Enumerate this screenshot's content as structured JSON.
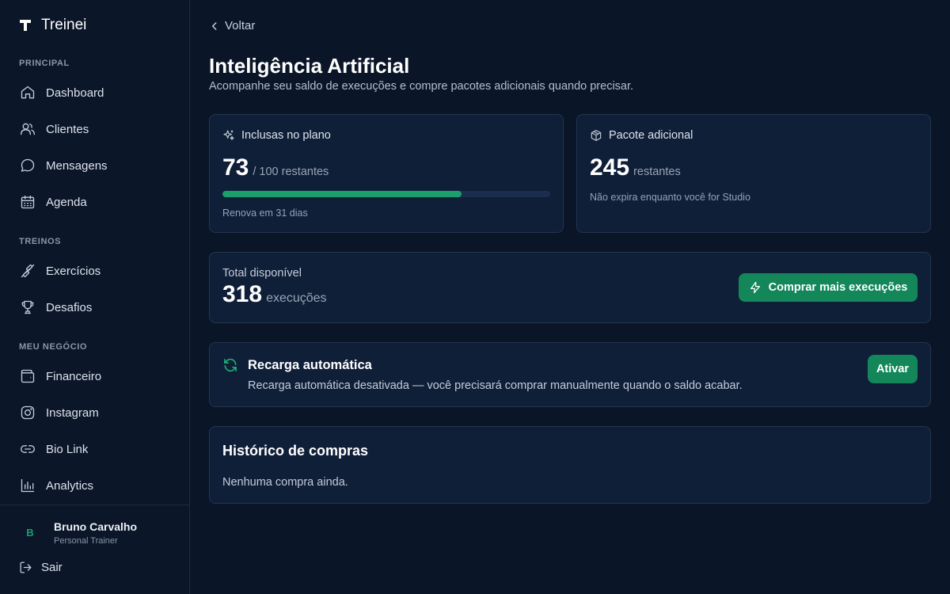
{
  "app": {
    "name": "Treinei"
  },
  "sidebar": {
    "sections": [
      {
        "title": "PRINCIPAL"
      },
      {
        "title": "TREINOS"
      },
      {
        "title": "MEU NEGÓCIO"
      }
    ],
    "items": [
      {
        "label": "Dashboard",
        "icon": "home-icon"
      },
      {
        "label": "Clientes",
        "icon": "users-icon"
      },
      {
        "label": "Mensagens",
        "icon": "message-icon"
      },
      {
        "label": "Agenda",
        "icon": "calendar-icon"
      },
      {
        "label": "Exercícios",
        "icon": "dumbbell-icon"
      },
      {
        "label": "Desafios",
        "icon": "trophy-icon"
      },
      {
        "label": "Financeiro",
        "icon": "wallet-icon"
      },
      {
        "label": "Instagram",
        "icon": "instagram-icon"
      },
      {
        "label": "Bio Link",
        "icon": "link-icon"
      },
      {
        "label": "Analytics",
        "icon": "bar-chart-icon"
      }
    ],
    "user": {
      "initial": "B",
      "name": "Bruno Carvalho",
      "role": "Personal Trainer"
    },
    "logout_label": "Sair"
  },
  "page": {
    "back_label": "Voltar",
    "title": "Inteligência Artificial",
    "subtitle": "Acompanhe seu saldo de execuções e compre pacotes adicionais quando precisar."
  },
  "plan_card": {
    "title": "Inclusas no plano",
    "remaining": "73",
    "remaining_suffix": "/ 100 restantes",
    "progress_fraction": 0.73,
    "renew_text": "Renova em 31 dias"
  },
  "package_card": {
    "title": "Pacote adicional",
    "remaining": "245",
    "remaining_suffix": "restantes",
    "note": "Não expira enquanto você for Studio"
  },
  "total_card": {
    "label": "Total disponível",
    "value": "318",
    "unit": "execuções",
    "buy_button": "Comprar mais execuções"
  },
  "recharge_card": {
    "title": "Recarga automática",
    "description": "Recarga automática desativada — você precisará comprar manualmente quando o saldo acabar.",
    "button": "Ativar"
  },
  "history_card": {
    "title": "Histórico de compras",
    "empty_text": "Nenhuma compra ainda."
  },
  "colors": {
    "accent": "#13875a",
    "progress": "#1b9f6b",
    "background": "#0a1628",
    "card": "#0f1f38"
  }
}
